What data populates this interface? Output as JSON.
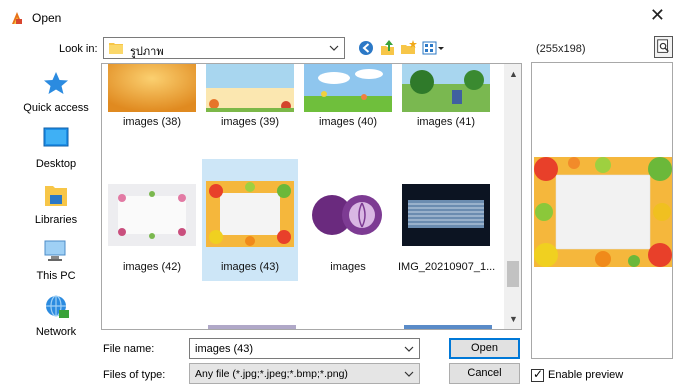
{
  "window": {
    "title": "Open",
    "close_glyph": "✕"
  },
  "toolbar": {
    "lookin_label": "Look in:",
    "current_folder": "รูปภาพ",
    "buttons": [
      "back-icon",
      "up-folder-icon",
      "new-folder-icon",
      "view-menu-icon"
    ]
  },
  "places": [
    {
      "label": "Quick access",
      "icon": "star-icon"
    },
    {
      "label": "Desktop",
      "icon": "desktop-icon"
    },
    {
      "label": "Libraries",
      "icon": "libraries-icon"
    },
    {
      "label": "This PC",
      "icon": "computer-icon"
    },
    {
      "label": "Network",
      "icon": "network-icon"
    }
  ],
  "files": [
    {
      "name": "images (38)",
      "thumb": "orange-gradient"
    },
    {
      "name": "images (39)",
      "thumb": "sky-flowers"
    },
    {
      "name": "images (40)",
      "thumb": "meadow-sky"
    },
    {
      "name": "images (41)",
      "thumb": "park-scene"
    },
    {
      "name": "images (42)",
      "thumb": "flower-frame"
    },
    {
      "name": "images (43)",
      "thumb": "fruit-frame",
      "selected": true
    },
    {
      "name": "images",
      "thumb": "red-cabbage"
    },
    {
      "name": "IMG_20210907_1...",
      "thumb": "dark-screen"
    }
  ],
  "preview": {
    "dimensions": "(255x198)",
    "enable_label": "Enable preview",
    "enabled": true
  },
  "form": {
    "filename_label": "File name:",
    "filename_value": "images (43)",
    "filetype_label": "Files of type:",
    "filetype_value": "Any file (*.jpg;*.jpeg;*.bmp;*.png)",
    "open_label": "Open",
    "cancel_label": "Cancel"
  },
  "colors": {
    "selection": "#cde6f7",
    "accent": "#0078d7",
    "folder": "#f7c648"
  }
}
